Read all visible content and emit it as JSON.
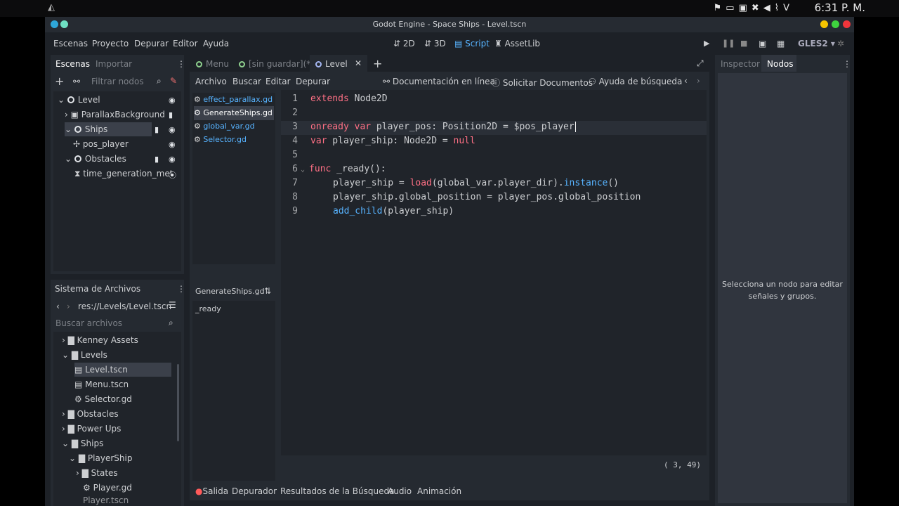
{
  "system": {
    "clock": "6:31 P. M."
  },
  "window": {
    "title": "Godot Engine - Space Ships - Level.tscn"
  },
  "menu": {
    "items": [
      "Escenas",
      "Proyecto",
      "Depurar",
      "Editor",
      "Ayuda"
    ]
  },
  "workspaces": {
    "2d": "2D",
    "3d": "3D",
    "script": "Script",
    "assetlib": "AssetLib"
  },
  "renderer": "GLES2",
  "scene_dock": {
    "tabs": [
      "Escenas",
      "Importar"
    ],
    "filter_placeholder": "Filtrar nodos",
    "nodes": [
      {
        "label": "Level"
      },
      {
        "label": "ParallaxBackground"
      },
      {
        "label": "Ships"
      },
      {
        "label": "pos_player"
      },
      {
        "label": "Obstacles"
      },
      {
        "label": "time_generation_met"
      }
    ]
  },
  "filesystem": {
    "title": "Sistema de Archivos",
    "path": "res://Levels/Level.tscn",
    "search_placeholder": "Buscar archivos",
    "items": [
      {
        "label": "Kenney Assets"
      },
      {
        "label": "Levels"
      },
      {
        "label": "Level.tscn"
      },
      {
        "label": "Menu.tscn"
      },
      {
        "label": "Selector.gd"
      },
      {
        "label": "Obstacles"
      },
      {
        "label": "Power Ups"
      },
      {
        "label": "Ships"
      },
      {
        "label": "PlayerShip"
      },
      {
        "label": "States"
      },
      {
        "label": "Player.gd"
      },
      {
        "label": "Player.tscn"
      }
    ]
  },
  "scene_tabs": {
    "menu": "Menu",
    "unsaved": "[sin guardar](*)",
    "level": "Level"
  },
  "script_menu": {
    "archivo": "Archivo",
    "buscar": "Buscar",
    "editar": "Editar",
    "depurar": "Depurar",
    "docs": "Documentación en línea",
    "solicitar": "Solicitar Documentos",
    "ayuda": "Ayuda de búsqueda"
  },
  "script_list": [
    "effect_parallax.gd",
    "GenerateShips.gd",
    "global_var.gd",
    "Selector.gd"
  ],
  "method_panel": {
    "title": "GenerateShips.gd",
    "methods": [
      "_ready"
    ]
  },
  "code": {
    "line_numbers": [
      "1",
      "2",
      "3",
      "4",
      "5",
      "6",
      "7",
      "8",
      "9"
    ],
    "l1_kw": "extends",
    "l1_rest": " Node2D",
    "l3_kw1": "onready",
    "l3_kw2": "var",
    "l3_a": " player_pos: ",
    "l3_ty": "Position2D",
    "l3_b": " = $pos_player",
    "l4_kw": "var",
    "l4_a": " player_ship: ",
    "l4_ty": "Node2D",
    "l4_b": " = ",
    "l4_null": "null",
    "l6_kw": "func",
    "l6_rest": " _ready():",
    "l7_a": "player_ship = ",
    "l7_fn": "load",
    "l7_b": "(global_var.player_dir).",
    "l7_fn2": "instance",
    "l7_c": "()",
    "l8": "player_ship.global_position = player_pos.global_position",
    "l9_fn": "add_child",
    "l9_rest": "(player_ship)"
  },
  "cursor_pos": "(   3, 49)",
  "right_dock": {
    "tabs": [
      "Inspector",
      "Nodos"
    ],
    "message_line1": "Selecciona un nodo para editar",
    "message_line2": "señales y grupos."
  },
  "bottom_panel": {
    "tabs": [
      "Salida",
      "Depurador",
      "Resultados de la Búsqueda",
      "Audio",
      "Animación"
    ]
  },
  "colors": {
    "accent": "#57b3ff",
    "keyword": "#ff7085",
    "type": "#8effda"
  }
}
